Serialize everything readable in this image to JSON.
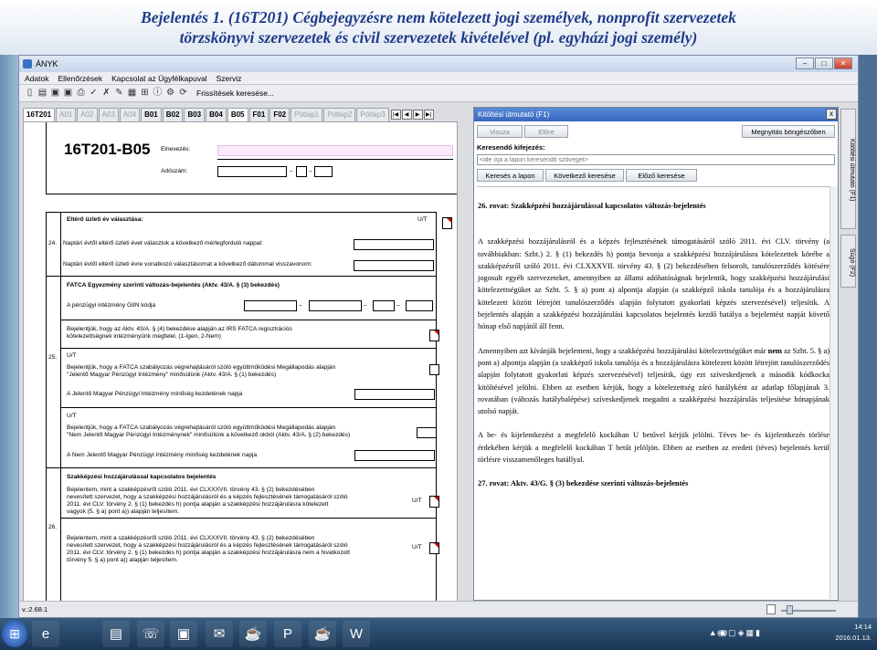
{
  "slide": {
    "title_line1": "Bejelentés 1. (16T201) Cégbejegyzésre nem kötelezett jogi személyek, nonprofit szervezetek",
    "title_line2": "törzskönyvi szervezetek és civil szervezetek kivételével (pl. egyházi jogi személy)"
  },
  "window": {
    "title": "ÁNYK",
    "min": "–",
    "max": "□",
    "close": "✕"
  },
  "menu": [
    "Adatok",
    "Ellenőrzések",
    "Kapcsolat az Ügyfélkapuval",
    "Szerviz"
  ],
  "toolbar": {
    "refresh_label": "Frissítések keresése..."
  },
  "tabs": [
    "16T201",
    "A01",
    "A02",
    "A03",
    "A04",
    "B01",
    "B02",
    "B03",
    "B04",
    "B05",
    "F01",
    "F02",
    "Pótlap1",
    "Pótlap2",
    "Pótlap3"
  ],
  "tab_nav": [
    "|◀",
    "◀",
    "▶",
    "▶|"
  ],
  "form": {
    "code": "16T201-B05",
    "elnevezes": "Elnevezés:",
    "adoszam": "Adószám:",
    "section_24_title": "Eltérő üzleti év választása:",
    "ut": "U/T",
    "row24": "24.",
    "line24a": "Naptári évtől eltérő üzleti évet választok a következő mérlegforduló nappal:",
    "line24b": "Naptári évtől eltérő üzleti évre vonatkozó választásomat a következő dátummal visszavonom:",
    "section_25_title": "FATCA Egyezmény szerinti változás-bejelentés (Aktv. 43/A. § (3) bekezdés)",
    "giin": "A pénzügyi intézmény GIIN kódja",
    "line25a1": "Bejelentjük, hogy az Aktv. 43/A. § (4) bekezdése alapján az IRS FATCA regisztrációs",
    "line25a2": "kötelezettségnek intézményünk megfelel. (1-Igen, 2-Nem)",
    "row25": "25.",
    "line25b1": "Bejelentjük, hogy a FATCA szabályozás végrehajtásáról szóló együttműködési Megállapodás alapján",
    "line25b2": "\"Jelentő Magyar Pénzügyi Intézmény\" minősülünk (Aktv. 43/A. § (1) bekezdés)",
    "line25c": "A Jelentő Magyar Pénzügyi Intézmény minőség kezdetének napja",
    "line25d1": "Bejelentjük, hogy a FATCA szabályozás végrehajtásáról szóló együttműködési Megállapodás alapján",
    "line25d2": "\"Nem Jelentő Magyar Pénzügyi Intézménynek\" minősülünk a következő okból (Aktv. 43/A. § (2) bekezdés)",
    "line25e": "A Nem Jelentő Magyar Pénzügyi Intézmény minőség kezdetének napja",
    "section_26_title": "Szakképzési hozzájárulással kapcsolatos bejelentés",
    "row26": "26.",
    "line26a1": "Bejelentem, mint a szakképzésről szóló 2011. évi CLXXXVII. törvény 43. § (2) bekezdésében",
    "line26a2": "nevesített szervezet, hogy a szakképzési hozzájárulásról és a képzés fejlesztésének támogatásáról szóló",
    "line26a3": "2011. évi CLV. törvény 2. § (1) bekezdés h) pontja alapján a szakképzési hozzájárulásra kötelezett",
    "line26a4": "vagyok (5. § a) pont a)) alapján teljesítem.",
    "line26b1": "Bejelentem, mint a szakképzésről szóló 2011. évi CLXXXVII. törvény 43. § (2) bekezdésében",
    "line26b2": "nevesített szervezet, hogy a szakképzési hozzájárulásról és a képzés fejlesztésének támogatásáról szóló",
    "line26b3": "2011. évi CLV. törvény 2. § (1) bekezdés h) pontja alapján a szakképzési hozzájárulásra nem a hivatkozott",
    "line26b4": "törvény 5. § a) pont a)) alapján teljesítem."
  },
  "help": {
    "title": "Kitöltési útmutató (F1)",
    "close": "x",
    "back": "Vissza",
    "forward": "Előre",
    "open_browser": "Megnyitás böngészőben",
    "search_label": "Keresendő kifejezés:",
    "search_placeholder": "<ide írja a lapon keresendő szöveget>",
    "search_page": "Keresés a lapon",
    "search_next": "Következő keresése",
    "search_prev": "Előző keresése",
    "heading": "26. rovat: Szakképzési hozzájárulással kapcsolatos változás-bejelentés",
    "para1": "A szakképzési hozzájárulásról és a képzés fejlesztésének támogatásáról szóló 2011. évi CLV. törvény (a továbbiakban: Szht.) 2. § (1) bekezdés h) pontja bevonja a szakképzési hozzájárulásra kötelezettek körébe a szakképzésről szóló 2011. évi CLXXXVII. törvény 43. § (2) bekezdésében felsorolt, tanulószerződés kötésére jogosult egyéb szervezeteket, amennyiben az állami adóhatóságnak bejelentik, hogy szakképzési hozzájárulási kötelezettségüket az Szht. 5. § a) pont a) alpontja alapján (a szakképző iskola tanulója és a hozzájárulásra kötelezett között létrejött tanulószerződés alapján folytatott gyakorlati képzés szervezésével) teljesítik. A bejelentés alapján a szakképzési hozzájárulási kapcsolatos bejelentés kezdő hatálya a bejelentést napját követő hónap első napjától áll fenn.",
    "para2_pre": "Amennyiben azt kívánják bejelenteni, hogy a szakképzési hozzájárulási kötelezettségüket már ",
    "para2_bold": "nem",
    "para2_post": " az Szht. 5. § a) pont a) alpontja alapján (a szakképző iskola tanulója és a hozzájárulásra kötelezett között létrejött tanulószerződés alapján folytatott gyakorlati képzés szervezésével) teljesítik, úgy ezt szíveskedjenek a második kódkocka kitöltésével jelölni. Ebben az esetben kérjük, hogy a kötelezettség záró hatályként az adatlap főlapjának 3. rovatában (változás hatálybalépése) szíveskedjenek megadni a szakképzési hozzájárulás teljesítése hónapjának utolsó napját.",
    "para3": "A be- és kijelentkezést a megfelelő kockában U betűvel kérjük jelölni. Téves be- és kijelentkezés törlése érdekében kérjük a megfelelő kockában T betűt jelöljön. Ebben az esetben az eredeti (téves) bejelentés kerül törlésre visszamenőleges hatállyal.",
    "heading2": "27. rovat: Aktv. 43/G. § (3) bekezdése szerinti változás-bejelentés"
  },
  "side_tabs": {
    "guide": "Kitöltési útmutató (F1)",
    "help": "Súgó (F2)"
  },
  "status": {
    "version": "v.:2.68.1"
  },
  "taskbar": {
    "lang": "HU",
    "time": "14:14",
    "date": "2016.01.13."
  }
}
